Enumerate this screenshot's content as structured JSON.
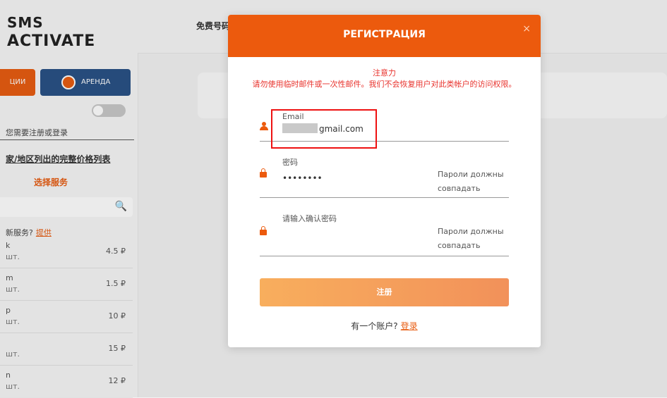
{
  "header": {
    "logo_line1": "SMS",
    "logo_line2": "ACTIVATE",
    "top_link": "免费号码"
  },
  "sidebar": {
    "tab_left": "ЦИИ",
    "tab_right": "АРЕНДА",
    "login_hint": "您需要注册或登录",
    "price_list_link": "家/地区列出的完整价格列表",
    "choose_service": "选择服务",
    "new_service_text": "新服务?",
    "new_service_link": "提供",
    "services": [
      {
        "name": "k",
        "qty": "шт.",
        "price": "4.5 ₽"
      },
      {
        "name": "m",
        "qty": "шт.",
        "price": "1.5 ₽"
      },
      {
        "name": "p",
        "qty": "шт.",
        "price": "10 ₽"
      },
      {
        "name": "",
        "qty": "шт.",
        "price": "15 ₽"
      },
      {
        "name": "n",
        "qty": "шт.",
        "price": "12 ₽"
      }
    ]
  },
  "modal": {
    "title": "РЕГИСТРАЦИЯ",
    "close": "×",
    "notice_title": "注意力",
    "notice_body": "请勿使用临时邮件或一次性邮件。我们不会恢复用户对此类帐户的访问权限。",
    "email_label": "Email",
    "email_value": "gmail.com",
    "password_label": "密码",
    "password_value": "••••••••",
    "password_hint": "Пароли должны совпадать",
    "confirm_label": "请输入确认密码",
    "confirm_hint": "Пароли должны совпадать",
    "submit_label": "注册",
    "have_account": "有一个账户?",
    "login_link": "登录"
  },
  "colors": {
    "accent": "#ec5a0d",
    "navy": "#2a5286",
    "warning": "#e8322c"
  }
}
